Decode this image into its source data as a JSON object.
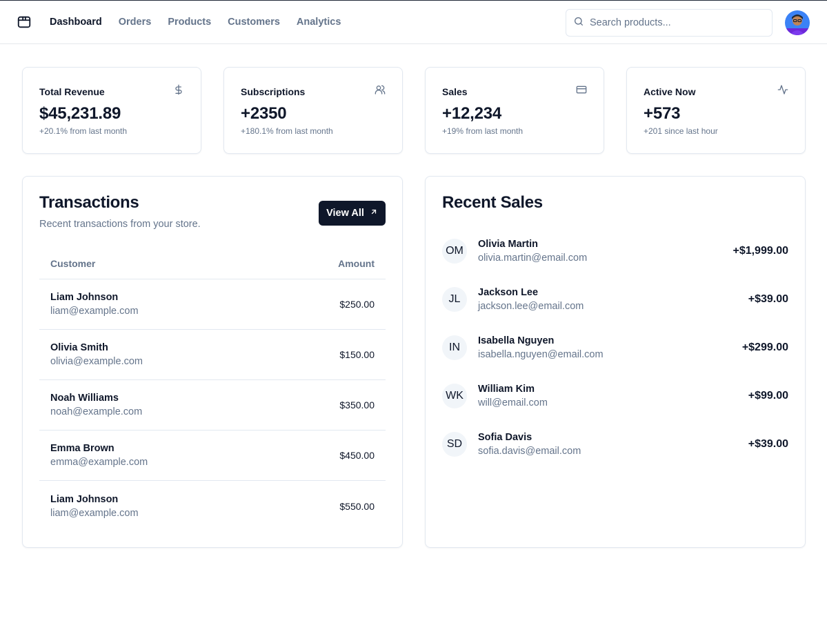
{
  "nav": {
    "items": [
      {
        "label": "Dashboard",
        "active": true
      },
      {
        "label": "Orders",
        "active": false
      },
      {
        "label": "Products",
        "active": false
      },
      {
        "label": "Customers",
        "active": false
      },
      {
        "label": "Analytics",
        "active": false
      }
    ]
  },
  "search": {
    "placeholder": "Search products...",
    "value": ""
  },
  "stats": [
    {
      "title": "Total Revenue",
      "value": "$45,231.89",
      "delta": "+20.1% from last month",
      "icon": "dollar-icon"
    },
    {
      "title": "Subscriptions",
      "value": "+2350",
      "delta": "+180.1% from last month",
      "icon": "users-icon"
    },
    {
      "title": "Sales",
      "value": "+12,234",
      "delta": "+19% from last month",
      "icon": "credit-card-icon"
    },
    {
      "title": "Active Now",
      "value": "+573",
      "delta": "+201 since last hour",
      "icon": "activity-icon"
    }
  ],
  "transactions": {
    "title": "Transactions",
    "subtitle": "Recent transactions from your store.",
    "view_all_label": "View All",
    "columns": {
      "customer": "Customer",
      "amount": "Amount"
    },
    "rows": [
      {
        "name": "Liam Johnson",
        "email": "liam@example.com",
        "amount": "$250.00"
      },
      {
        "name": "Olivia Smith",
        "email": "olivia@example.com",
        "amount": "$150.00"
      },
      {
        "name": "Noah Williams",
        "email": "noah@example.com",
        "amount": "$350.00"
      },
      {
        "name": "Emma Brown",
        "email": "emma@example.com",
        "amount": "$450.00"
      },
      {
        "name": "Liam Johnson",
        "email": "liam@example.com",
        "amount": "$550.00"
      }
    ]
  },
  "recent_sales": {
    "title": "Recent Sales",
    "items": [
      {
        "initials": "OM",
        "name": "Olivia Martin",
        "email": "olivia.martin@email.com",
        "amount": "+$1,999.00"
      },
      {
        "initials": "JL",
        "name": "Jackson Lee",
        "email": "jackson.lee@email.com",
        "amount": "+$39.00"
      },
      {
        "initials": "IN",
        "name": "Isabella Nguyen",
        "email": "isabella.nguyen@email.com",
        "amount": "+$299.00"
      },
      {
        "initials": "WK",
        "name": "William Kim",
        "email": "will@email.com",
        "amount": "+$99.00"
      },
      {
        "initials": "SD",
        "name": "Sofia Davis",
        "email": "sofia.davis@email.com",
        "amount": "+$39.00"
      }
    ]
  },
  "colors": {
    "primary": "#0f172a",
    "muted": "#64748b",
    "border": "#e2e8f0",
    "avatar_bg": "#3b82f6"
  }
}
